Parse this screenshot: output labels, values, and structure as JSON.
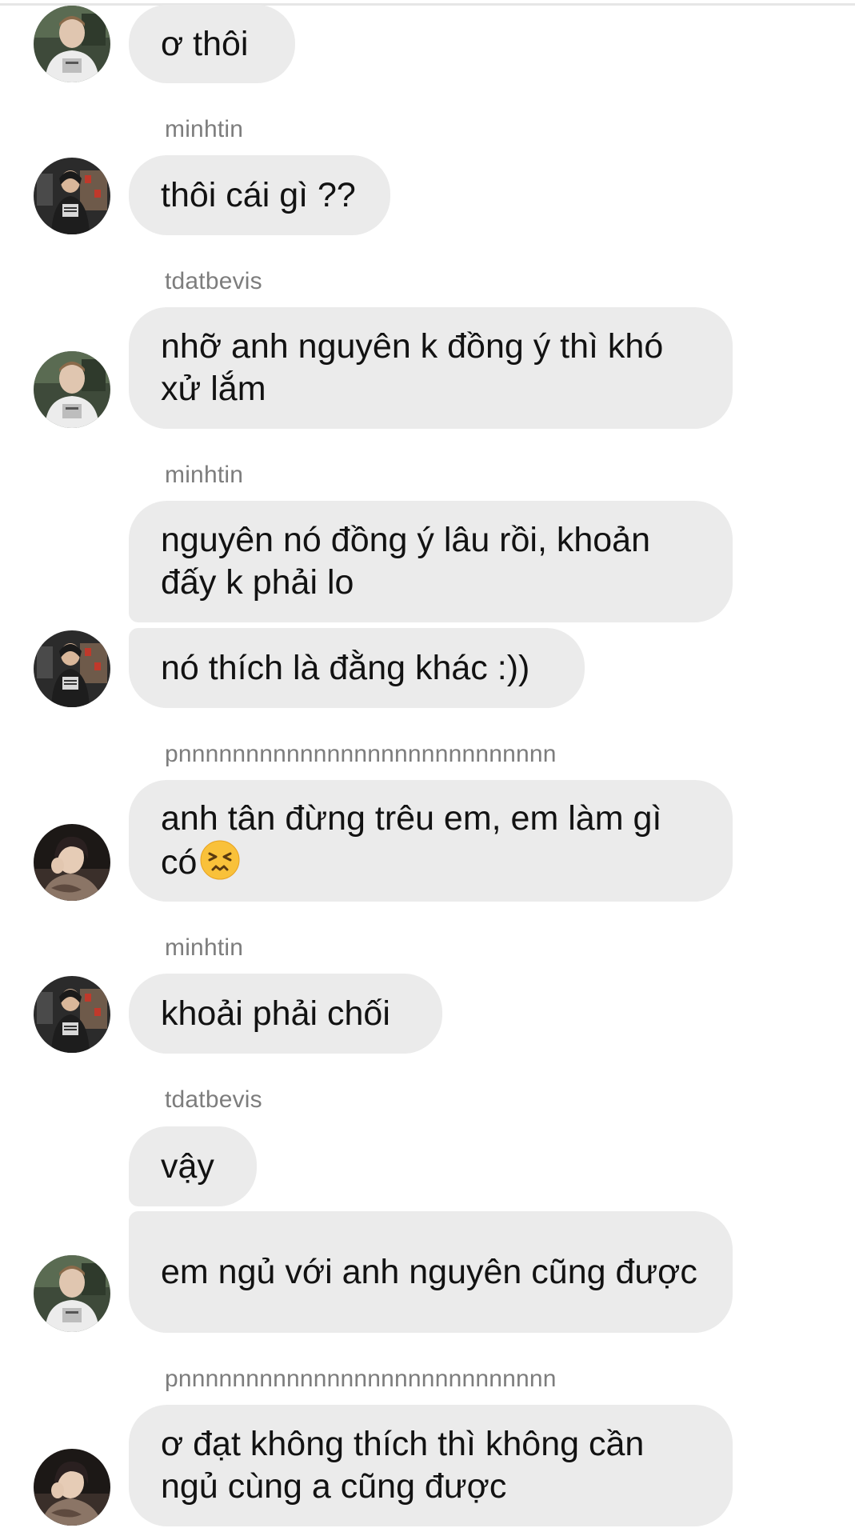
{
  "messages": [
    {
      "sender": "",
      "text": "ơ thôi"
    },
    {
      "sender": "minhtin",
      "text": "thôi cái gì ??"
    },
    {
      "sender": "tdatbevis",
      "text": "nhỡ anh nguyên k đồng ý thì khó xử lắm"
    },
    {
      "sender": "minhtin",
      "text": "nguyên nó đồng ý lâu rồi, khoản đấy k phải lo"
    },
    {
      "sender": "",
      "text": "nó thích là đằng khác :))"
    },
    {
      "sender": "pnnnnnnnnnnnnnnnnnnnnnnnnnnnn",
      "text": "anh tân đừng trêu em, em làm gì có",
      "emoji": "persevering-face-emoji"
    },
    {
      "sender": "minhtin",
      "text": "khoải phải chối"
    },
    {
      "sender": "tdatbevis",
      "text": "vậy"
    },
    {
      "sender": "",
      "text": "em ngủ với anh nguyên cũng được"
    },
    {
      "sender": "pnnnnnnnnnnnnnnnnnnnnnnnnnnnn",
      "text": "ơ đạt không thích thì không cần ngủ cùng a cũng được"
    }
  ],
  "colors": {
    "bubble": "#ebebeb",
    "sender_name": "#7d7d7d",
    "text": "#121212"
  },
  "icons": {
    "avatar_tdatbevis": "avatar-tdatbevis",
    "avatar_minhtin": "avatar-minhtin",
    "avatar_pn": "avatar-pnnnn"
  }
}
